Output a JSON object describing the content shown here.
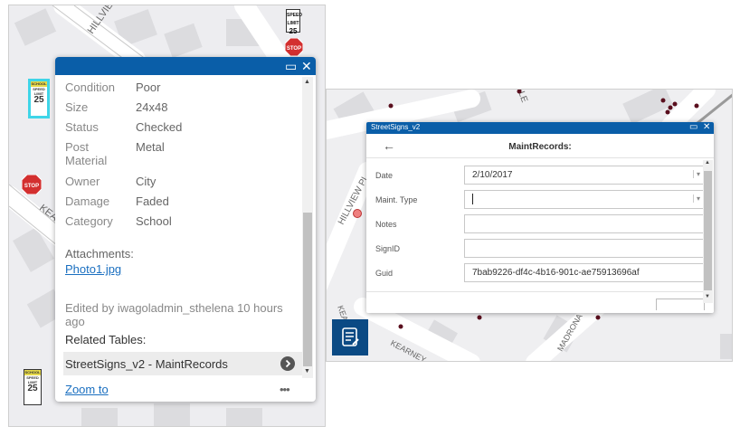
{
  "left_map": {
    "streets": [
      "HILLVIEW PL",
      "KEA"
    ],
    "signs": {
      "stop": "STOP",
      "school": "SCHOOL",
      "speed_limit_label": "SPEED LIMIT",
      "speed_value": "25"
    }
  },
  "popup": {
    "fields": [
      {
        "label": "Condition",
        "value": "Poor"
      },
      {
        "label": "Size",
        "value": "24x48"
      },
      {
        "label": "Status",
        "value": "Checked"
      },
      {
        "label": "Post Material",
        "value": "Metal"
      },
      {
        "label": "Owner",
        "value": "City"
      },
      {
        "label": "Damage",
        "value": "Faded"
      },
      {
        "label": "Category",
        "value": "School"
      }
    ],
    "attachments_label": "Attachments:",
    "attachment_link": "Photo1.jpg",
    "edited_by": "Edited by iwagoladmin_sthelena 10 hours ago",
    "related_tables_label": "Related Tables:",
    "related_table": "StreetSigns_v2 - MaintRecords",
    "zoom_to": "Zoom to",
    "more": "•••",
    "maximize_glyph": "▭",
    "close_glyph": "✕"
  },
  "right_map": {
    "streets": [
      "HILLVIEW PL",
      "ALE",
      "KEARNEY ST",
      "MADRONA",
      "KEARNEY"
    ],
    "dialog": {
      "title": "StreetSigns_v2",
      "subtitle": "MaintRecords:",
      "back_glyph": "←",
      "fields": [
        {
          "label": "Date",
          "value": "2/10/2017",
          "type": "dropdown"
        },
        {
          "label": "Maint. Type",
          "value": "",
          "type": "dropdown"
        },
        {
          "label": "Notes",
          "value": "",
          "type": "text"
        },
        {
          "label": "SignID",
          "value": "",
          "type": "text"
        },
        {
          "label": "Guid",
          "value": "7bab9226-df4c-4b16-901c-ae75913696af",
          "type": "text"
        }
      ]
    },
    "colors": {
      "header": "#0a5ea8",
      "widget_bg": "#0b4a84"
    }
  }
}
